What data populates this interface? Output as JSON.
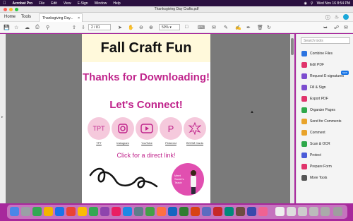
{
  "menubar": {
    "app": "Acrobat Pro",
    "items": [
      "File",
      "Edit",
      "View",
      "E-Sign",
      "Window",
      "Help"
    ],
    "datetime": "Wed Nov 16 8:54 PM"
  },
  "window": {
    "title": "Thanksgiving Day Crafts.pdf"
  },
  "tabs": {
    "home": "Home",
    "tools": "Tools",
    "file_tab": "Thanksgiving Day..."
  },
  "toolbar": {
    "page_current": "2",
    "page_total": "/ 81",
    "zoom": "50%"
  },
  "document": {
    "banner": "Fall Craft Fun",
    "thanks": "Thanks for Downloading!",
    "connect": "Let's Connect!",
    "links": [
      {
        "icon_text": "TPT",
        "label": "TPT"
      },
      {
        "icon_text": "",
        "label": "Instagram"
      },
      {
        "icon_text": "",
        "label": "YouTube"
      },
      {
        "icon_text": "P",
        "label": "Pinterest"
      },
      {
        "icon_text": "",
        "label": "BOOM Cards"
      }
    ],
    "click_text": "Click for a direct link!",
    "photo_text_1": "Meet",
    "photo_text_2": "Sarah's",
    "photo_text_3": "Teach"
  },
  "tools_panel": {
    "search_placeholder": "Search tools",
    "new_badge": "NEW",
    "items": [
      {
        "label": "Combine Files",
        "color": "#2b73e0"
      },
      {
        "label": "Edit PDF",
        "color": "#e0336b"
      },
      {
        "label": "Request E-signatures",
        "color": "#7c4dcf"
      },
      {
        "label": "Fill & Sign",
        "color": "#7c4dcf"
      },
      {
        "label": "Export PDF",
        "color": "#e0336b"
      },
      {
        "label": "Organize Pages",
        "color": "#2ea84a"
      },
      {
        "label": "Send for Comments",
        "color": "#e8a32a"
      },
      {
        "label": "Comment",
        "color": "#e8a32a"
      },
      {
        "label": "Scan & OCR",
        "color": "#2ea84a"
      },
      {
        "label": "Protect",
        "color": "#4a5bd8"
      },
      {
        "label": "Prepare Form",
        "color": "#e0336b"
      },
      {
        "label": "More Tools",
        "color": "#555555"
      }
    ]
  },
  "colors": {
    "accent": "#c0258c",
    "desktop": "#a7289c"
  }
}
